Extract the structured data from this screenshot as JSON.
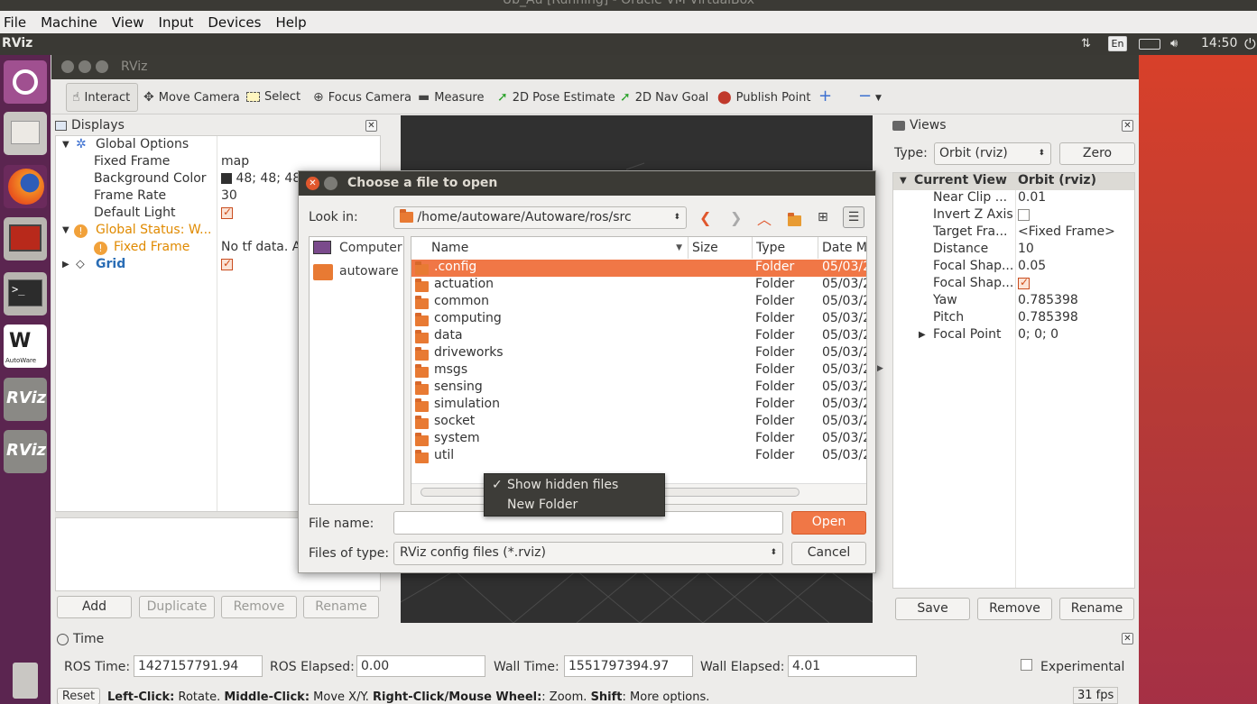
{
  "vbox": {
    "title": "Ub_Au [Running] - Oracle VM VirtualBox",
    "menu": [
      "File",
      "Machine",
      "View",
      "Input",
      "Devices",
      "Help"
    ]
  },
  "panel": {
    "app_name": "RViz",
    "lang": "En",
    "clock": "14:50"
  },
  "launcher": {
    "items": [
      "ubuntu-dash",
      "files",
      "firefox",
      "system-monitor",
      "terminal",
      "autoware",
      "rviz",
      "rviz"
    ],
    "autoware_label": "AutoWare",
    "rviz_label": "RViz"
  },
  "rviz": {
    "title": "RViz",
    "toolbar": {
      "interact": "Interact",
      "move_camera": "Move Camera",
      "select": "Select",
      "focus_camera": "Focus Camera",
      "measure": "Measure",
      "pose_estimate": "2D Pose Estimate",
      "nav_goal": "2D Nav Goal",
      "publish_point": "Publish Point",
      "plus": "+",
      "minus": "−"
    },
    "displays": {
      "title": "Displays",
      "global_options": "Global Options",
      "fixed_frame_label": "Fixed Frame",
      "fixed_frame_value": "map",
      "bg_color_label": "Background Color",
      "bg_color_value": "48; 48; 48",
      "frame_rate_label": "Frame Rate",
      "frame_rate_value": "30",
      "default_light_label": "Default Light",
      "global_status": "Global Status: W...",
      "status_fixed_frame": "Fixed Frame",
      "status_fixed_frame_value": "No tf data.  A",
      "grid": "Grid",
      "buttons": {
        "add": "Add",
        "duplicate": "Duplicate",
        "remove": "Remove",
        "rename": "Rename"
      }
    },
    "views": {
      "title": "Views",
      "type_label": "Type:",
      "type_value": "Orbit (rviz)",
      "zero": "Zero",
      "current_view": "Current View",
      "current_view_value": "Orbit (rviz)",
      "rows": [
        {
          "k": "Near Clip ...",
          "v": "0.01"
        },
        {
          "k": "Invert Z Axis",
          "v": ""
        },
        {
          "k": "Target Fra...",
          "v": "<Fixed Frame>"
        },
        {
          "k": "Distance",
          "v": "10"
        },
        {
          "k": "Focal Shap...",
          "v": "0.05"
        },
        {
          "k": "Focal Shap...",
          "v": ""
        },
        {
          "k": "Yaw",
          "v": "0.785398"
        },
        {
          "k": "Pitch",
          "v": "0.785398"
        },
        {
          "k": "Focal Point",
          "v": "0; 0; 0"
        }
      ],
      "buttons": {
        "save": "Save",
        "remove": "Remove",
        "rename": "Rename"
      }
    },
    "time": {
      "title": "Time",
      "ros_time_label": "ROS Time:",
      "ros_time": "1427157791.94",
      "ros_elapsed_label": "ROS Elapsed:",
      "ros_elapsed": "0.00",
      "wall_time_label": "Wall Time:",
      "wall_time": "1551797394.97",
      "wall_elapsed_label": "Wall Elapsed:",
      "wall_elapsed": "4.01",
      "experimental": "Experimental"
    },
    "status": {
      "reset": "Reset",
      "help_b1": "Left-Click:",
      "help_t1": " Rotate. ",
      "help_b2": "Middle-Click:",
      "help_t2": " Move X/Y. ",
      "help_b3": "Right-Click/Mouse Wheel:",
      "help_t3": ": Zoom. ",
      "help_b4": "Shift",
      "help_t4": ": More options.",
      "fps": "31 fps"
    }
  },
  "dialog": {
    "title": "Choose a file to open",
    "look_in_label": "Look in:",
    "look_in_value": "/home/autoware/Autoware/ros/src",
    "places": [
      "Computer",
      "autoware"
    ],
    "columns": {
      "name": "Name",
      "size": "Size",
      "type": "Type",
      "date": "Date M"
    },
    "files": [
      {
        "name": ".config",
        "type": "Folder",
        "date": "05/03/2"
      },
      {
        "name": "actuation",
        "type": "Folder",
        "date": "05/03/2"
      },
      {
        "name": "common",
        "type": "Folder",
        "date": "05/03/2"
      },
      {
        "name": "computing",
        "type": "Folder",
        "date": "05/03/2"
      },
      {
        "name": "data",
        "type": "Folder",
        "date": "05/03/2"
      },
      {
        "name": "driveworks",
        "type": "Folder",
        "date": "05/03/2"
      },
      {
        "name": "msgs",
        "type": "Folder",
        "date": "05/03/2"
      },
      {
        "name": "sensing",
        "type": "Folder",
        "date": "05/03/2"
      },
      {
        "name": "simulation",
        "type": "Folder",
        "date": "05/03/2"
      },
      {
        "name": "socket",
        "type": "Folder",
        "date": "05/03/2"
      },
      {
        "name": "system",
        "type": "Folder",
        "date": "05/03/2"
      },
      {
        "name": "util",
        "type": "Folder",
        "date": "05/03/2"
      }
    ],
    "file_name_label": "File name:",
    "file_name_value": "",
    "files_of_type_label": "Files of type:",
    "files_of_type_value": "RViz config files (*.rviz)",
    "open": "Open",
    "cancel": "Cancel",
    "context_menu": {
      "show_hidden": "Show hidden files",
      "new_folder": "New Folder"
    }
  },
  "colors": {
    "accent": "#f07746",
    "launcher": "#5b2550",
    "render_bg": "#303030",
    "status_orange": "#e67e00",
    "grid_blue": "#2a6db5"
  }
}
